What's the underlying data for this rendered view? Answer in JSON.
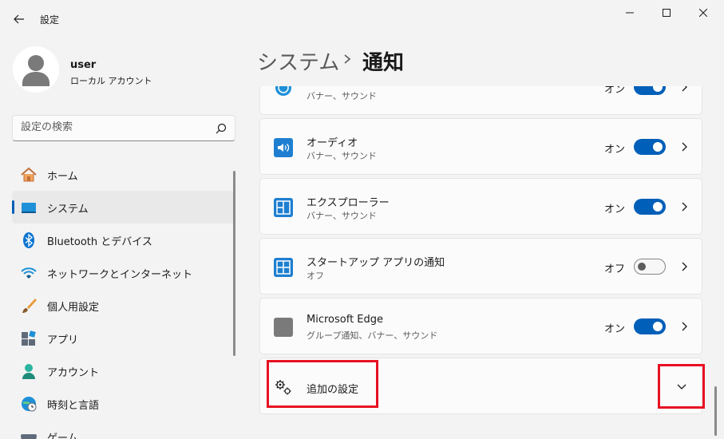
{
  "window": {
    "title": "設定",
    "back_icon": "back-arrow-icon",
    "minimize_icon": "minimize-icon",
    "maximize_icon": "maximize-icon",
    "close_icon": "close-icon"
  },
  "profile": {
    "name": "user",
    "account_type": "ローカル アカウント"
  },
  "search": {
    "placeholder": "設定の検索",
    "icon": "search-icon"
  },
  "nav": [
    {
      "label": "ホーム",
      "icon": "home-icon",
      "active": false
    },
    {
      "label": "システム",
      "icon": "monitor-icon",
      "active": true
    },
    {
      "label": "Bluetooth とデバイス",
      "icon": "bluetooth-icon",
      "active": false
    },
    {
      "label": "ネットワークとインターネット",
      "icon": "wifi-icon",
      "active": false
    },
    {
      "label": "個人用設定",
      "icon": "brush-icon",
      "active": false
    },
    {
      "label": "アプリ",
      "icon": "apps-icon",
      "active": false
    },
    {
      "label": "アカウント",
      "icon": "person-icon",
      "active": false
    },
    {
      "label": "時刻と言語",
      "icon": "globe-clock-icon",
      "active": false
    },
    {
      "label": "ゲーム",
      "icon": "gamepad-icon",
      "active": false
    }
  ],
  "breadcrumb": {
    "parent": "システム",
    "current": "通知"
  },
  "notifications": [
    {
      "title": "",
      "subtitle": "バナー、サウンド",
      "state": "オン",
      "on": true,
      "icon": "app-icon"
    },
    {
      "title": "オーディオ",
      "subtitle": "バナー、サウンド",
      "state": "オン",
      "on": true,
      "icon": "speaker-icon"
    },
    {
      "title": "エクスプローラー",
      "subtitle": "バナー、サウンド",
      "state": "オン",
      "on": true,
      "icon": "explorer-icon"
    },
    {
      "title": "スタートアップ アプリの通知",
      "subtitle": "オフ",
      "state": "オフ",
      "on": false,
      "icon": "startup-apps-icon"
    },
    {
      "title": "Microsoft Edge",
      "subtitle": "グループ通知、バナー、サウンド",
      "state": "オン",
      "on": true,
      "icon": "edge-icon"
    }
  ],
  "additional": {
    "label": "追加の設定",
    "icon": "gears-icon",
    "expand_icon": "chevron-down-icon"
  },
  "colors": {
    "accent": "#005fb8",
    "highlight": "#e81123"
  }
}
